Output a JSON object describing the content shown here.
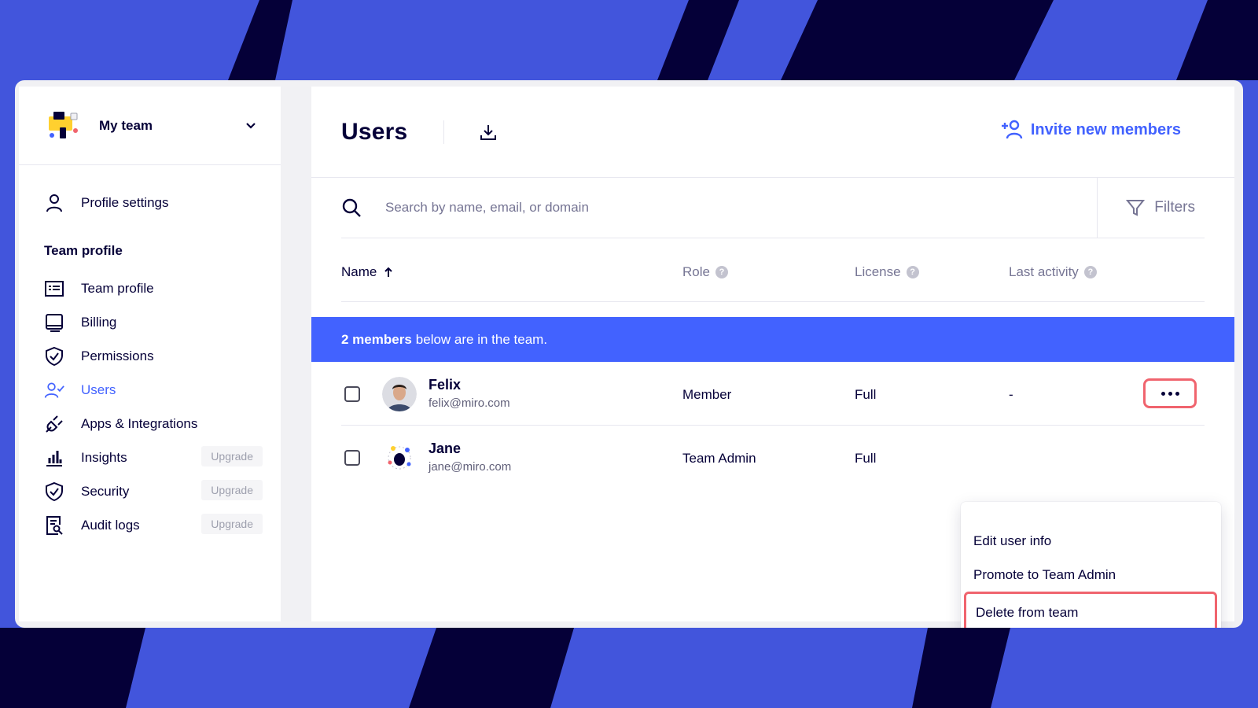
{
  "colors": {
    "background": "#4255dc",
    "stripe": "#050038",
    "accent": "#4262ff",
    "highlight": "#f0646e",
    "text": "#050038",
    "muted": "#767594"
  },
  "sidebar": {
    "team_name": "My team",
    "profile_settings": "Profile settings",
    "section_title": "Team profile",
    "items": [
      {
        "label": "Team profile",
        "icon": "id-card-icon"
      },
      {
        "label": "Billing",
        "icon": "billing-icon"
      },
      {
        "label": "Permissions",
        "icon": "shield-check-icon"
      },
      {
        "label": "Users",
        "icon": "users-check-icon",
        "active": true
      },
      {
        "label": "Apps & Integrations",
        "icon": "plug-icon"
      },
      {
        "label": "Insights",
        "icon": "bar-chart-icon",
        "badge": "Upgrade"
      },
      {
        "label": "Security",
        "icon": "shield-check-icon",
        "badge": "Upgrade"
      },
      {
        "label": "Audit logs",
        "icon": "audit-log-icon",
        "badge": "Upgrade"
      }
    ]
  },
  "header": {
    "title": "Users",
    "invite_label": "Invite new members"
  },
  "search": {
    "placeholder": "Search by name, email, or domain",
    "filters_label": "Filters"
  },
  "table": {
    "columns": {
      "name": "Name",
      "role": "Role",
      "license": "License",
      "last_activity": "Last activity"
    },
    "banner_count": "2 members",
    "banner_text": "below are in the team.",
    "rows": [
      {
        "name": "Felix",
        "email": "felix@miro.com",
        "role": "Member",
        "license": "Full",
        "last_activity": "-"
      },
      {
        "name": "Jane",
        "email": "jane@miro.com",
        "role": "Team Admin",
        "license": "Full",
        "last_activity": ""
      }
    ]
  },
  "context_menu": {
    "items": [
      "Edit user info",
      "Promote to Team Admin",
      "Delete from team"
    ],
    "highlighted": "Delete from team"
  }
}
